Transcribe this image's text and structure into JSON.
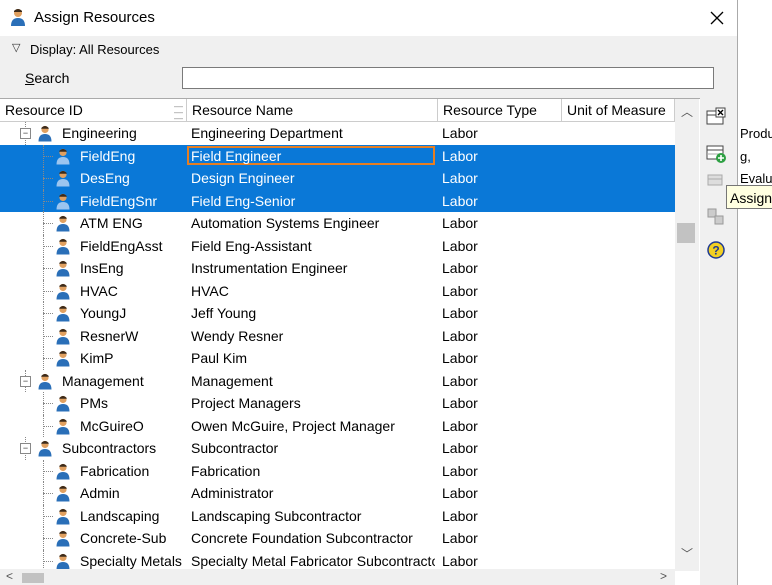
{
  "window": {
    "title": "Assign Resources",
    "close_label": "×"
  },
  "display": {
    "label": "Display: All Resources"
  },
  "search": {
    "label_first": "S",
    "label_rest": "earch",
    "value": "",
    "placeholder": ""
  },
  "columns": [
    "Resource ID",
    "Resource Name",
    "Resource Type",
    "Unit of Measure"
  ],
  "rows": [
    {
      "id": "Engineering",
      "name": "Engineering Department",
      "type": "Labor",
      "level": 0,
      "group": true,
      "selected": false
    },
    {
      "id": "FieldEng",
      "name": "Field Engineer",
      "type": "Labor",
      "level": 1,
      "group": false,
      "selected": true,
      "focused": true
    },
    {
      "id": "DesEng",
      "name": "Design Engineer",
      "type": "Labor",
      "level": 1,
      "group": false,
      "selected": true
    },
    {
      "id": "FieldEngSnr",
      "name": "Field Eng-Senior",
      "type": "Labor",
      "level": 1,
      "group": false,
      "selected": true
    },
    {
      "id": "ATM ENG",
      "name": "Automation Systems Engineer",
      "type": "Labor",
      "level": 1,
      "group": false,
      "selected": false
    },
    {
      "id": "FieldEngAsst",
      "name": "Field Eng-Assistant",
      "type": "Labor",
      "level": 1,
      "group": false,
      "selected": false
    },
    {
      "id": "InsEng",
      "name": "Instrumentation Engineer",
      "type": "Labor",
      "level": 1,
      "group": false,
      "selected": false
    },
    {
      "id": "HVAC",
      "name": "HVAC",
      "type": "Labor",
      "level": 1,
      "group": false,
      "selected": false
    },
    {
      "id": "YoungJ",
      "name": "Jeff Young",
      "type": "Labor",
      "level": 1,
      "group": false,
      "selected": false
    },
    {
      "id": "ResnerW",
      "name": "Wendy Resner",
      "type": "Labor",
      "level": 1,
      "group": false,
      "selected": false
    },
    {
      "id": "KimP",
      "name": "Paul Kim",
      "type": "Labor",
      "level": 1,
      "group": false,
      "selected": false
    },
    {
      "id": "Management",
      "name": "Management",
      "type": "Labor",
      "level": 0,
      "group": true,
      "selected": false
    },
    {
      "id": "PMs",
      "name": "Project Managers",
      "type": "Labor",
      "level": 1,
      "group": false,
      "selected": false
    },
    {
      "id": "McGuireO",
      "name": "Owen McGuire, Project Manager",
      "type": "Labor",
      "level": 1,
      "group": false,
      "selected": false
    },
    {
      "id": "Subcontractors",
      "name": "Subcontractor",
      "type": "Labor",
      "level": 0,
      "group": true,
      "selected": false
    },
    {
      "id": "Fabrication",
      "name": "Fabrication",
      "type": "Labor",
      "level": 1,
      "group": false,
      "selected": false
    },
    {
      "id": "Admin",
      "name": "Administrator",
      "type": "Labor",
      "level": 1,
      "group": false,
      "selected": false
    },
    {
      "id": "Landscaping",
      "name": "Landscaping Subcontractor",
      "type": "Labor",
      "level": 1,
      "group": false,
      "selected": false
    },
    {
      "id": "Concrete-Sub",
      "name": "Concrete Foundation Subcontractor",
      "type": "Labor",
      "level": 1,
      "group": false,
      "selected": false
    },
    {
      "id": "Specialty Metals",
      "name": "Specialty Metal Fabricator Subcontractor",
      "type": "Labor",
      "level": 1,
      "group": false,
      "selected": false
    }
  ],
  "toolbar": {
    "tooltip": "Assign"
  },
  "background": {
    "lines": [
      "Produ",
      "g,",
      "Evalua"
    ]
  },
  "colors": {
    "selection": "#0a78d7",
    "focus": "#e67e22",
    "person_body": "#2a6fb8",
    "person_skin": "#e0a060"
  }
}
